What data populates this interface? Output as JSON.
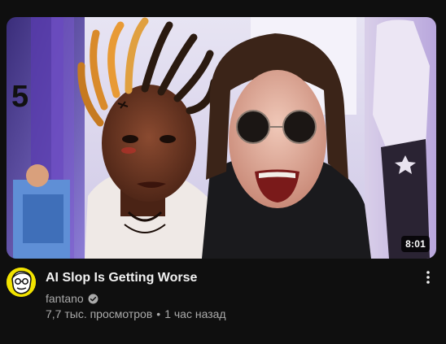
{
  "video": {
    "title": "AI Slop Is Getting Worse",
    "duration": "8:01",
    "channel": "fantano",
    "views": "7,7 тыс. просмотров",
    "separator": "•",
    "age": "1 час назад"
  },
  "icons": {
    "verified": "verified-check-icon",
    "menu": "more-vert-icon",
    "avatar": "channel-avatar-icon"
  },
  "colors": {
    "background": "#0f0f0f",
    "title": "#f1f1f1",
    "secondary_text": "#aaaaaa",
    "avatar_bg": "#f2e300"
  }
}
